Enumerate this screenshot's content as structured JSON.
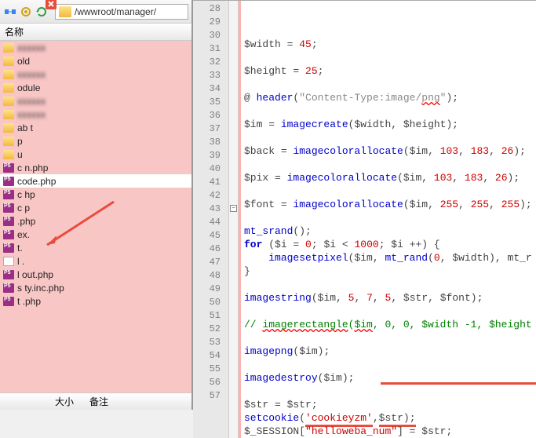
{
  "path": "/wwwroot/manager/",
  "col_name": "名称",
  "footer": {
    "size": "大小",
    "note": "备注"
  },
  "files": [
    {
      "type": "folder",
      "name": "",
      "blur": true
    },
    {
      "type": "folder",
      "name": "    old"
    },
    {
      "type": "folder",
      "name": "",
      "blur": true
    },
    {
      "type": "folder",
      "name": "    odule"
    },
    {
      "type": "folder",
      "name": "",
      "blur": true
    },
    {
      "type": "folder",
      "name": "",
      "blur": true
    },
    {
      "type": "folder",
      "name": "ab   t"
    },
    {
      "type": "folder",
      "name": "     p"
    },
    {
      "type": "folder",
      "name": "u   "
    },
    {
      "type": "php",
      "name": "c     n.php"
    },
    {
      "type": "php",
      "name": "code.php",
      "sel": true
    },
    {
      "type": "php",
      "name": "c      hp"
    },
    {
      "type": "php",
      "name": "c        p"
    },
    {
      "type": "php",
      "name": "     .php"
    },
    {
      "type": "php",
      "name": "   ex.   "
    },
    {
      "type": "php",
      "name": "   t.   "
    },
    {
      "type": "file",
      "name": "l   .   "
    },
    {
      "type": "php",
      "name": "l    out.php"
    },
    {
      "type": "php",
      "name": "s       ty.inc.php"
    },
    {
      "type": "php",
      "name": "t     .php"
    }
  ],
  "code": {
    "start": 28,
    "foldLine": 43,
    "lines": [
      {
        "t": [
          [
            "var",
            "$width"
          ],
          [
            "op",
            " = "
          ],
          [
            "num",
            "45"
          ],
          [
            "op",
            ";"
          ]
        ]
      },
      {
        "t": []
      },
      {
        "t": [
          [
            "var",
            "$height"
          ],
          [
            "op",
            " = "
          ],
          [
            "num",
            "25"
          ],
          [
            "op",
            ";"
          ]
        ]
      },
      {
        "t": []
      },
      {
        "t": [
          [
            "op",
            "@ "
          ],
          [
            "fn",
            "header"
          ],
          [
            "op",
            "("
          ],
          [
            "str",
            "\"Content-Type:image/"
          ],
          [
            "squig",
            "png"
          ],
          [
            "str",
            "\""
          ],
          [
            "op",
            ");"
          ]
        ]
      },
      {
        "t": []
      },
      {
        "t": [
          [
            "var",
            "$im"
          ],
          [
            "op",
            " = "
          ],
          [
            "fn",
            "imagecreate"
          ],
          [
            "op",
            "("
          ],
          [
            "var",
            "$width"
          ],
          [
            "op",
            ", "
          ],
          [
            "var",
            "$height"
          ],
          [
            "op",
            ");"
          ]
        ]
      },
      {
        "t": []
      },
      {
        "t": [
          [
            "var",
            "$back"
          ],
          [
            "op",
            " = "
          ],
          [
            "fn",
            "imagecolorallocate"
          ],
          [
            "op",
            "("
          ],
          [
            "var",
            "$im"
          ],
          [
            "op",
            ", "
          ],
          [
            "num",
            "103"
          ],
          [
            "op",
            ", "
          ],
          [
            "num",
            "183"
          ],
          [
            "op",
            ", "
          ],
          [
            "num",
            "26"
          ],
          [
            "op",
            ");"
          ]
        ]
      },
      {
        "t": []
      },
      {
        "t": [
          [
            "var",
            "$pix"
          ],
          [
            "op",
            " = "
          ],
          [
            "fn",
            "imagecolorallocate"
          ],
          [
            "op",
            "("
          ],
          [
            "var",
            "$im"
          ],
          [
            "op",
            ", "
          ],
          [
            "num",
            "103"
          ],
          [
            "op",
            ", "
          ],
          [
            "num",
            "183"
          ],
          [
            "op",
            ", "
          ],
          [
            "num",
            "26"
          ],
          [
            "op",
            ");"
          ]
        ]
      },
      {
        "t": []
      },
      {
        "t": [
          [
            "var",
            "$font"
          ],
          [
            "op",
            " = "
          ],
          [
            "fn",
            "imagecolorallocate"
          ],
          [
            "op",
            "("
          ],
          [
            "var",
            "$im"
          ],
          [
            "op",
            ", "
          ],
          [
            "num",
            "255"
          ],
          [
            "op",
            ", "
          ],
          [
            "num",
            "255"
          ],
          [
            "op",
            ", "
          ],
          [
            "num",
            "255"
          ],
          [
            "op",
            ");"
          ]
        ]
      },
      {
        "t": []
      },
      {
        "t": [
          [
            "fn",
            "mt_srand"
          ],
          [
            "op",
            "();"
          ]
        ]
      },
      {
        "t": [
          [
            "kw",
            "for"
          ],
          [
            "op",
            " ("
          ],
          [
            "var",
            "$i"
          ],
          [
            "op",
            " = "
          ],
          [
            "num",
            "0"
          ],
          [
            "op",
            "; "
          ],
          [
            "var",
            "$i"
          ],
          [
            "op",
            " < "
          ],
          [
            "num",
            "1000"
          ],
          [
            "op",
            "; "
          ],
          [
            "var",
            "$i"
          ],
          [
            "op",
            " ++) {"
          ]
        ]
      },
      {
        "t": [
          [
            "op",
            "    "
          ],
          [
            "fn",
            "imagesetpixel"
          ],
          [
            "op",
            "("
          ],
          [
            "var",
            "$im"
          ],
          [
            "op",
            ", "
          ],
          [
            "fn",
            "mt_rand"
          ],
          [
            "op",
            "("
          ],
          [
            "num",
            "0"
          ],
          [
            "op",
            ", "
          ],
          [
            "var",
            "$width"
          ],
          [
            "op",
            "), "
          ],
          [
            "var",
            "mt_r"
          ]
        ]
      },
      {
        "t": [
          [
            "op",
            "}"
          ]
        ]
      },
      {
        "t": []
      },
      {
        "t": [
          [
            "fn",
            "imagestring"
          ],
          [
            "op",
            "("
          ],
          [
            "var",
            "$im"
          ],
          [
            "op",
            ", "
          ],
          [
            "num",
            "5"
          ],
          [
            "op",
            ", "
          ],
          [
            "num",
            "7"
          ],
          [
            "op",
            ", "
          ],
          [
            "num",
            "5"
          ],
          [
            "op",
            ", "
          ],
          [
            "var",
            "$str"
          ],
          [
            "op",
            ", "
          ],
          [
            "var",
            "$font"
          ],
          [
            "op",
            ");"
          ]
        ]
      },
      {
        "t": []
      },
      {
        "t": [
          [
            "cmt",
            "// "
          ],
          [
            "cmtsquig",
            "imagerectangle"
          ],
          [
            "cmt",
            "("
          ],
          [
            "cmtsquig",
            "$im"
          ],
          [
            "cmt",
            ", 0, 0, $width -1, $height"
          ]
        ]
      },
      {
        "t": []
      },
      {
        "t": [
          [
            "fn",
            "imagepng"
          ],
          [
            "op",
            "("
          ],
          [
            "var",
            "$im"
          ],
          [
            "op",
            ");"
          ]
        ]
      },
      {
        "t": []
      },
      {
        "t": [
          [
            "fn",
            "imagedestroy"
          ],
          [
            "op",
            "("
          ],
          [
            "var",
            "$im"
          ],
          [
            "op",
            ");"
          ]
        ]
      },
      {
        "t": []
      },
      {
        "t": [
          [
            "var",
            "$str"
          ],
          [
            "op",
            " = "
          ],
          [
            "var",
            "$str"
          ],
          [
            "op",
            ";"
          ]
        ]
      },
      {
        "t": [
          [
            "fn",
            "setcookie"
          ],
          [
            "op",
            "("
          ],
          [
            "str2u",
            "'cookieyzm'"
          ],
          [
            "op",
            ","
          ],
          [
            "varu",
            "$str"
          ],
          [
            "opu",
            ");"
          ]
        ]
      },
      {
        "t": [
          [
            "varu",
            "$_SESSION"
          ],
          [
            "opu",
            "["
          ],
          [
            "str2u",
            "\"helloweba_num\""
          ],
          [
            "opu",
            "]"
          ],
          [
            "op",
            " = "
          ],
          [
            "var",
            "$str"
          ],
          [
            "op",
            ";"
          ]
        ]
      }
    ]
  }
}
